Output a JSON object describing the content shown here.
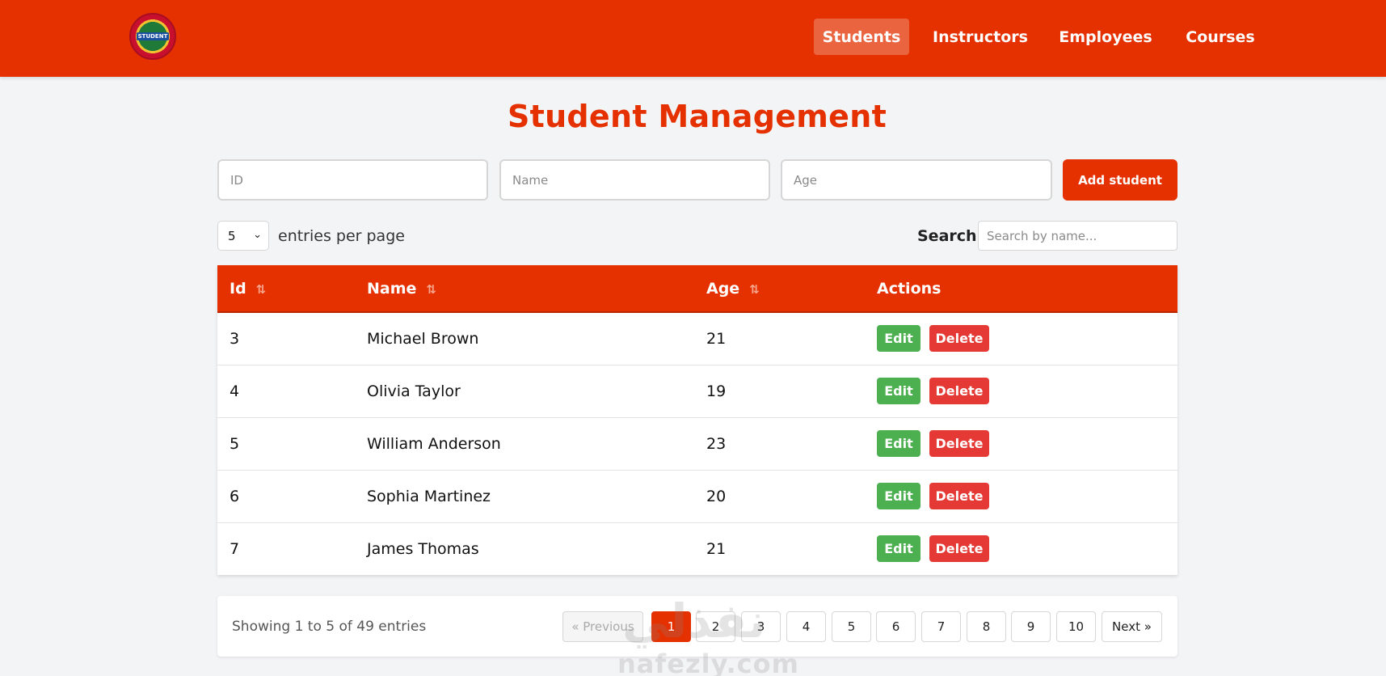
{
  "brand": {
    "logo_text": "STUDENT"
  },
  "nav": {
    "items": [
      {
        "label": "Students",
        "active": true
      },
      {
        "label": "Instructors",
        "active": false
      },
      {
        "label": "Employees",
        "active": false
      },
      {
        "label": "Courses",
        "active": false
      }
    ]
  },
  "page": {
    "title": "Student Management"
  },
  "form": {
    "id_placeholder": "ID",
    "name_placeholder": "Name",
    "age_placeholder": "Age",
    "add_label": "Add student"
  },
  "controls": {
    "entries_value": "5",
    "entries_label": "entries per page",
    "search_label": "Search:",
    "search_placeholder": "Search by name..."
  },
  "table": {
    "headers": {
      "id": "Id",
      "name": "Name",
      "age": "Age",
      "actions": "Actions"
    },
    "edit_label": "Edit",
    "delete_label": "Delete",
    "rows": [
      {
        "id": "3",
        "name": "Michael Brown",
        "age": "21"
      },
      {
        "id": "4",
        "name": "Olivia Taylor",
        "age": "19"
      },
      {
        "id": "5",
        "name": "William Anderson",
        "age": "23"
      },
      {
        "id": "6",
        "name": "Sophia Martinez",
        "age": "20"
      },
      {
        "id": "7",
        "name": "James Thomas",
        "age": "21"
      }
    ]
  },
  "pagination": {
    "showing": "Showing 1 to 5 of 49 entries",
    "previous": "« Previous",
    "next": "Next »",
    "pages": [
      "1",
      "2",
      "3",
      "4",
      "5",
      "6",
      "7",
      "8",
      "9",
      "10"
    ],
    "current": "1"
  },
  "watermark": {
    "text": "nafezly.com",
    "arabic": "نفذلي"
  },
  "colors": {
    "primary": "#e53000",
    "edit": "#4caf50",
    "delete": "#e53935",
    "background": "#f3f4f6"
  }
}
